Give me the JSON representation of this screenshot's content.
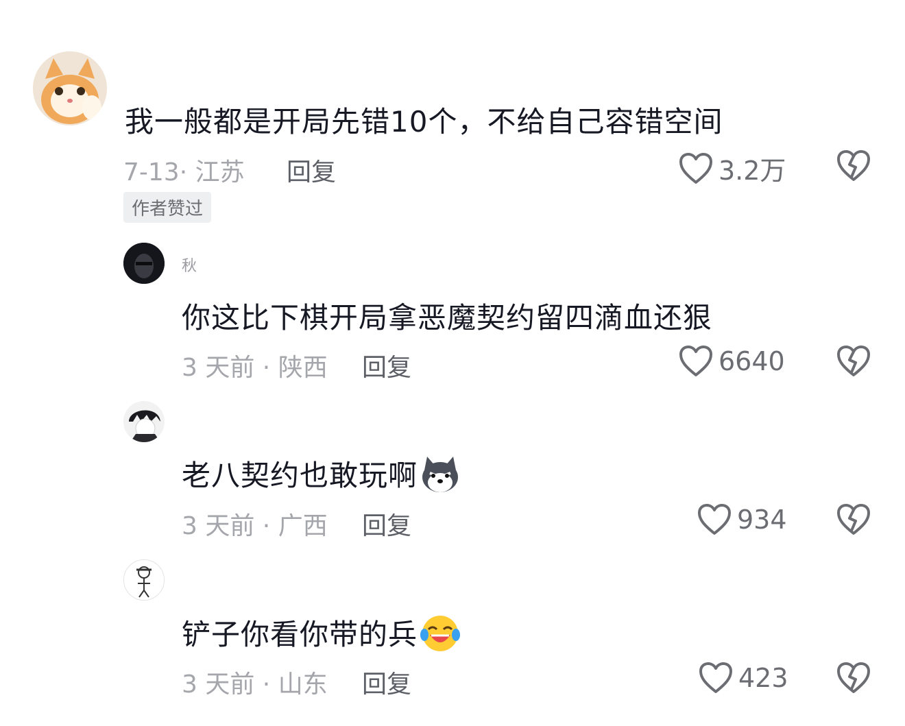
{
  "comments": [
    {
      "username": "",
      "text": "我一般都是开局先错10个，不给自己容错空间",
      "date": "7-13",
      "location": "江苏",
      "reply_label": "回复",
      "likes": "3.2万",
      "badge": "作者赞过",
      "avatar": "cat-avatar"
    },
    {
      "username": "秋",
      "text": "你这比下棋开局拿恶魔契约留四滴血还狠",
      "date": "3 天前",
      "location": "陕西",
      "reply_label": "回复",
      "likes": "6640",
      "avatar": "dark-portrait-avatar"
    },
    {
      "username": "",
      "text": "老八契约也敢玩啊",
      "date": "3 天前",
      "location": "广西",
      "reply_label": "回复",
      "likes": "934",
      "emoji": "husky-emoji",
      "avatar": "anime-boy-avatar"
    },
    {
      "username": "",
      "text": "铲子你看你带的兵",
      "date": "3 天前",
      "location": "山东",
      "reply_label": "回复",
      "likes": "423",
      "emoji": "laughing-crying-emoji",
      "avatar": "sketch-avatar"
    }
  ],
  "colors": {
    "text": "#161823",
    "meta": "#a4a6ab",
    "reply": "#5d5f66",
    "icon": "#6b6d72"
  }
}
